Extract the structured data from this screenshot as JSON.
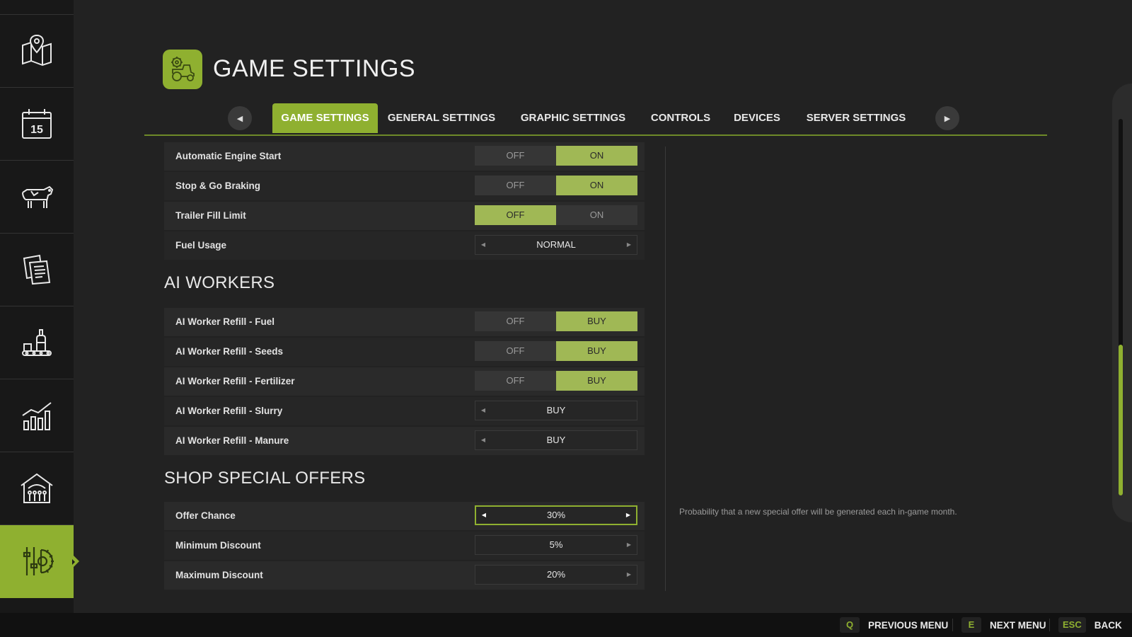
{
  "page": {
    "title": "GAME SETTINGS",
    "icon": "tractor-gear-icon"
  },
  "sidebar": {
    "items": [
      {
        "name": "map",
        "icon": "map-pin-icon",
        "active": false
      },
      {
        "name": "calendar",
        "icon": "calendar-icon",
        "label": "15",
        "active": false
      },
      {
        "name": "animals",
        "icon": "cow-icon",
        "active": false
      },
      {
        "name": "contracts",
        "icon": "documents-icon",
        "active": false
      },
      {
        "name": "production",
        "icon": "production-icon",
        "active": false
      },
      {
        "name": "statistics",
        "icon": "chart-icon",
        "active": false
      },
      {
        "name": "workers",
        "icon": "farm-building-icon",
        "active": false
      },
      {
        "name": "settings",
        "icon": "settings-sliders-icon",
        "active": true
      }
    ]
  },
  "tabs": [
    {
      "label": "GAME SETTINGS",
      "active": true
    },
    {
      "label": "GENERAL SETTINGS",
      "active": false
    },
    {
      "label": "GRAPHIC SETTINGS",
      "active": false
    },
    {
      "label": "CONTROLS",
      "active": false
    },
    {
      "label": "DEVICES",
      "active": false
    },
    {
      "label": "SERVER SETTINGS",
      "active": false
    }
  ],
  "settings_top": [
    {
      "label": "Automatic Engine Start",
      "options": [
        "OFF",
        "ON"
      ],
      "selected": 1
    },
    {
      "label": "Stop & Go Braking",
      "options": [
        "OFF",
        "ON"
      ],
      "selected": 1
    },
    {
      "label": "Trailer Fill Limit",
      "options": [
        "OFF",
        "ON"
      ],
      "selected": 0
    },
    {
      "label": "Fuel Usage",
      "value": "NORMAL"
    }
  ],
  "ai_workers": {
    "title": "AI WORKERS",
    "rows": [
      {
        "label": "AI Worker Refill - Fuel",
        "options": [
          "OFF",
          "BUY"
        ],
        "selected": 1
      },
      {
        "label": "AI Worker Refill - Seeds",
        "options": [
          "OFF",
          "BUY"
        ],
        "selected": 1
      },
      {
        "label": "AI Worker Refill - Fertilizer",
        "options": [
          "OFF",
          "BUY"
        ],
        "selected": 1
      },
      {
        "label": "AI Worker Refill - Slurry",
        "value": "BUY"
      },
      {
        "label": "AI Worker Refill - Manure",
        "value": "BUY"
      }
    ]
  },
  "shop_offers": {
    "title": "SHOP SPECIAL OFFERS",
    "rows": [
      {
        "label": "Offer Chance",
        "value": "30%"
      },
      {
        "label": "Minimum Discount",
        "value": "5%"
      },
      {
        "label": "Maximum Discount",
        "value": "20%"
      }
    ]
  },
  "description": "Probability that a new special offer will be generated each in-game month.",
  "scroll": {
    "position_fraction": 0.6,
    "visible_fraction": 0.4
  },
  "bottom_hints": [
    {
      "key": "Q",
      "label": "PREVIOUS MENU"
    },
    {
      "key": "E",
      "label": "NEXT MENU"
    },
    {
      "key": "ESC",
      "label": "BACK"
    }
  ],
  "colors": {
    "accent": "#8fb030",
    "selected_option": "#a0b855",
    "background": "#222222",
    "sidebar": "#181818"
  }
}
